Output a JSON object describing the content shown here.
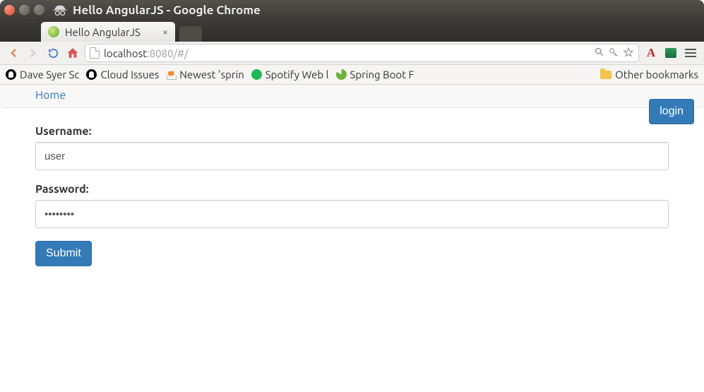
{
  "window": {
    "title": "Hello AngularJS - Google Chrome"
  },
  "tab": {
    "title": "Hello AngularJS",
    "favicon": "leaf-green"
  },
  "nav": {
    "url_host": "localhost",
    "url_rest": ":8080/#/",
    "icons": {
      "back": "back-arrow",
      "forward": "forward-arrow",
      "reload": "reload",
      "home": "home",
      "zoom": "magnifier",
      "perm": "key",
      "star": "star",
      "font": "A",
      "ext": "green-rect",
      "menu": "hamburger"
    }
  },
  "bookmarks": {
    "items": [
      {
        "icon": "github",
        "label": "Dave Syer Sc"
      },
      {
        "icon": "github",
        "label": "Cloud Issues"
      },
      {
        "icon": "stackoverflow",
        "label": "Newest 'sprin"
      },
      {
        "icon": "spotify",
        "label": "Spotify Web l"
      },
      {
        "icon": "spring",
        "label": "Spring Boot F"
      }
    ],
    "other_label": "Other bookmarks"
  },
  "page": {
    "home_link": "Home",
    "login_btn": "login",
    "form": {
      "username_label": "Username:",
      "username_value": "user",
      "password_label": "Password:",
      "password_value": "••••••••",
      "submit_label": "Submit"
    }
  },
  "colors": {
    "primary": "#337ab7",
    "primary_border": "#2e6da4",
    "link": "#337ab7"
  }
}
